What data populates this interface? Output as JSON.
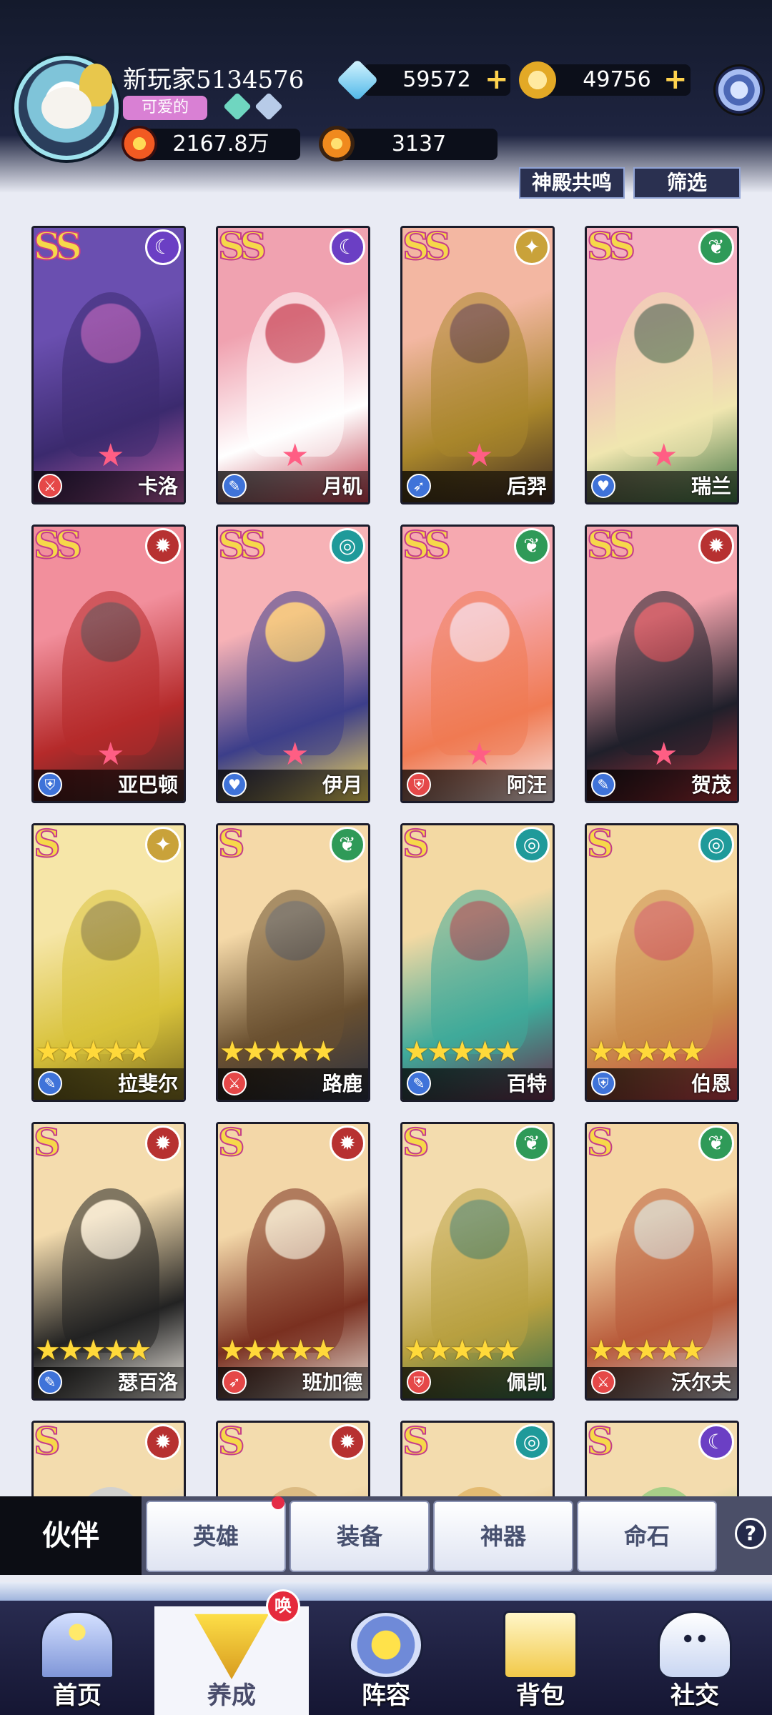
{
  "player": {
    "name": "新玩家5134576",
    "title_tag": "可爱的",
    "power": "2167.8万",
    "honor": "3137"
  },
  "currency": {
    "diamonds": "59572",
    "gold": "49756"
  },
  "actions": {
    "resonance": "神殿共鸣",
    "filter": "筛选"
  },
  "heroes": [
    {
      "rank": "SS",
      "name": "卡洛",
      "element": "moon",
      "element_color": "#6b3fc4",
      "cls": "warrior",
      "cls_color": "#e54848",
      "stars": 1,
      "art": [
        "#6a4fb0",
        "#3b2a6e",
        "#c05fa8"
      ]
    },
    {
      "rank": "SS",
      "name": "月矶",
      "element": "moon",
      "element_color": "#6b3fc4",
      "cls": "mage",
      "cls_color": "#3f73d9",
      "stars": 1,
      "art": [
        "#f0a2b0",
        "#ffffff",
        "#c03a4a"
      ]
    },
    {
      "rank": "SS",
      "name": "后羿",
      "element": "light",
      "element_color": "#c9a23a",
      "cls": "archer",
      "cls_color": "#3f73d9",
      "stars": 1,
      "art": [
        "#f3b7a2",
        "#a9862b",
        "#3d2a22"
      ]
    },
    {
      "rank": "SS",
      "name": "瑞兰",
      "element": "forest",
      "element_color": "#2f9a58",
      "cls": "support",
      "cls_color": "#3f73d9",
      "stars": 1,
      "art": [
        "#f3b0c0",
        "#f0e6b0",
        "#3a7040"
      ]
    },
    {
      "rank": "SS",
      "name": "亚巴顿",
      "element": "fire",
      "element_color": "#b73131",
      "cls": "tank",
      "cls_color": "#3f73d9",
      "stars": 1,
      "art": [
        "#f28f9c",
        "#b52a2a",
        "#3b2a2a"
      ]
    },
    {
      "rank": "SS",
      "name": "伊月",
      "element": "water",
      "element_color": "#1f9a9a",
      "cls": "support",
      "cls_color": "#3f73d9",
      "stars": 1,
      "art": [
        "#f7b2b6",
        "#3c3e8a",
        "#f3d85a"
      ]
    },
    {
      "rank": "SS",
      "name": "阿汪",
      "element": "forest",
      "element_color": "#2f9a58",
      "cls": "tank",
      "cls_color": "#e54848",
      "stars": 1,
      "art": [
        "#f6a9b0",
        "#f07a52",
        "#f6e8e8"
      ]
    },
    {
      "rank": "SS",
      "name": "贺茂",
      "element": "fire",
      "element_color": "#b73131",
      "cls": "mage",
      "cls_color": "#3f73d9",
      "stars": 1,
      "art": [
        "#f3a3ac",
        "#1f1f2a",
        "#b5323a"
      ]
    },
    {
      "rank": "S",
      "name": "拉斐尔",
      "element": "light",
      "element_color": "#c9a23a",
      "cls": "mage",
      "cls_color": "#3f73d9",
      "stars": 5,
      "art": [
        "#f6e6a8",
        "#d8c23a",
        "#7a6a20"
      ]
    },
    {
      "rank": "S",
      "name": "路鹿",
      "element": "forest",
      "element_color": "#2f9a58",
      "cls": "warrior",
      "cls_color": "#e54848",
      "stars": 5,
      "art": [
        "#f5d9a8",
        "#6a5030",
        "#2a3040"
      ]
    },
    {
      "rank": "S",
      "name": "百特",
      "element": "water",
      "element_color": "#1f9a9a",
      "cls": "mage",
      "cls_color": "#3f73d9",
      "stars": 5,
      "art": [
        "#f3d9a3",
        "#3faa9a",
        "#6a2a4a"
      ]
    },
    {
      "rank": "S",
      "name": "伯恩",
      "element": "water",
      "element_color": "#1f9a9a",
      "cls": "tank",
      "cls_color": "#3f73d9",
      "stars": 5,
      "art": [
        "#f4d8a0",
        "#c98a4a",
        "#c23a4a"
      ]
    },
    {
      "rank": "S",
      "name": "瑟百洛",
      "element": "fire",
      "element_color": "#b73131",
      "cls": "mage",
      "cls_color": "#3f73d9",
      "stars": 5,
      "art": [
        "#f4dcae",
        "#222",
        "#f5f0e8"
      ]
    },
    {
      "rank": "S",
      "name": "班加德",
      "element": "fire",
      "element_color": "#b73131",
      "cls": "archer",
      "cls_color": "#e54848",
      "stars": 5,
      "art": [
        "#f3d7a8",
        "#7a3020",
        "#e8e0d8"
      ]
    },
    {
      "rank": "S",
      "name": "佩凯",
      "element": "forest",
      "element_color": "#2f9a58",
      "cls": "tank",
      "cls_color": "#e54848",
      "stars": 5,
      "art": [
        "#f3dcae",
        "#b8a040",
        "#2e6a4a"
      ]
    },
    {
      "rank": "S",
      "name": "沃尔夫",
      "element": "forest",
      "element_color": "#2f9a58",
      "cls": "warrior",
      "cls_color": "#e54848",
      "stars": 5,
      "art": [
        "#f4d6a4",
        "#b85a3a",
        "#c8c8d0"
      ]
    },
    {
      "rank": "S",
      "name": "",
      "element": "fire",
      "element_color": "#b73131",
      "cls": "",
      "cls_color": "#3f73d9",
      "stars": 0,
      "art": [
        "#f3dcae",
        "#b8c8e8",
        "#fff"
      ]
    },
    {
      "rank": "S",
      "name": "",
      "element": "fire",
      "element_color": "#b73131",
      "cls": "",
      "cls_color": "#3f73d9",
      "stars": 0,
      "art": [
        "#f3dcae",
        "#c8a060",
        "#e8eef8"
      ]
    },
    {
      "rank": "S",
      "name": "",
      "element": "water",
      "element_color": "#1f9a9a",
      "cls": "",
      "cls_color": "#3f73d9",
      "stars": 0,
      "art": [
        "#f3dcae",
        "#d8a040",
        "#6a5030"
      ]
    },
    {
      "rank": "S",
      "name": "",
      "element": "moon",
      "element_color": "#6b3fc4",
      "cls": "",
      "cls_color": "#3f73d9",
      "stars": 0,
      "art": [
        "#f3dcae",
        "#6ac46a",
        "#8a2a3a"
      ]
    }
  ],
  "tabs": {
    "active": "伙伴",
    "items": [
      "英雄",
      "装备",
      "神器",
      "命石"
    ]
  },
  "help_label": "?",
  "nav": {
    "items": [
      "首页",
      "养成",
      "阵容",
      "背包",
      "社交"
    ],
    "active_index": 1,
    "badge": "唤"
  }
}
